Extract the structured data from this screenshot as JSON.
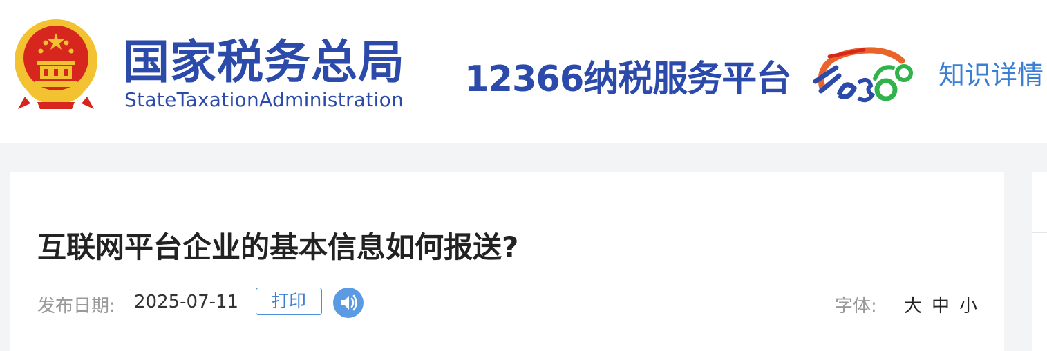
{
  "header": {
    "org_name_cn": "国家税务总局",
    "org_name_en": "StateTaxationAdministration",
    "platform_name": "12366纳税服务平台",
    "logo_text": "12366",
    "knowledge_link": "知识详情"
  },
  "article": {
    "title": "互联网平台企业的基本信息如何报送?",
    "date_label": "发布日期:",
    "date_value": "2025-07-11",
    "print_label": "打印",
    "font_label": "字体:",
    "font_sizes": {
      "large": "大",
      "medium": "中",
      "small": "小"
    }
  },
  "colors": {
    "brand_blue": "#2b4aa9",
    "link_blue": "#3b7fd4",
    "audio_blue": "#5b9be3",
    "emblem_red": "#d7261e",
    "emblem_gold": "#f3c230"
  },
  "icons": {
    "emblem": "national-emblem-icon",
    "logo": "12366-logo-icon",
    "audio": "speaker-icon"
  }
}
